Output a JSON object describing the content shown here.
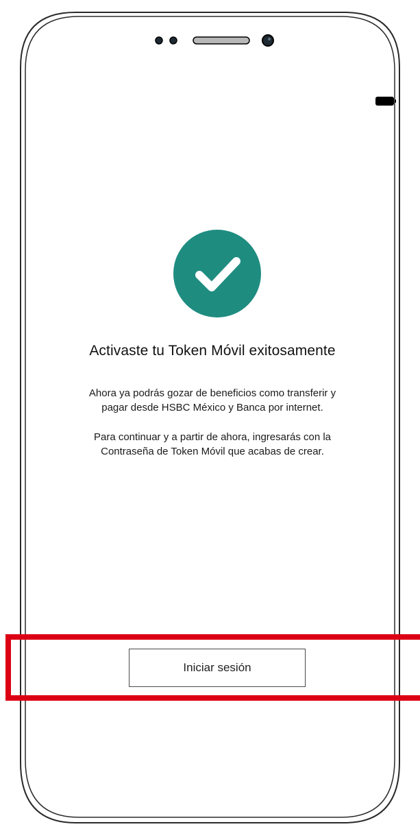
{
  "colors": {
    "success": "#1f8c80",
    "highlight": "#dc0014",
    "text": "#111111"
  },
  "status_bar": {
    "battery_icon": "battery-icon"
  },
  "success": {
    "icon": "checkmark-circle-icon",
    "title": "Activaste tu Token Móvil exitosamente",
    "paragraph1_line1": "Ahora ya podrás gozar de beneficios como transferir y",
    "paragraph1_line2": "pagar desde HSBC México y Banca por internet.",
    "paragraph2_line1": "Para continuar y a partir de ahora, ingresarás con la",
    "paragraph2_line2": "Contraseña de Token Móvil que acabas de crear."
  },
  "actions": {
    "login_label": "Iniciar sesión"
  }
}
